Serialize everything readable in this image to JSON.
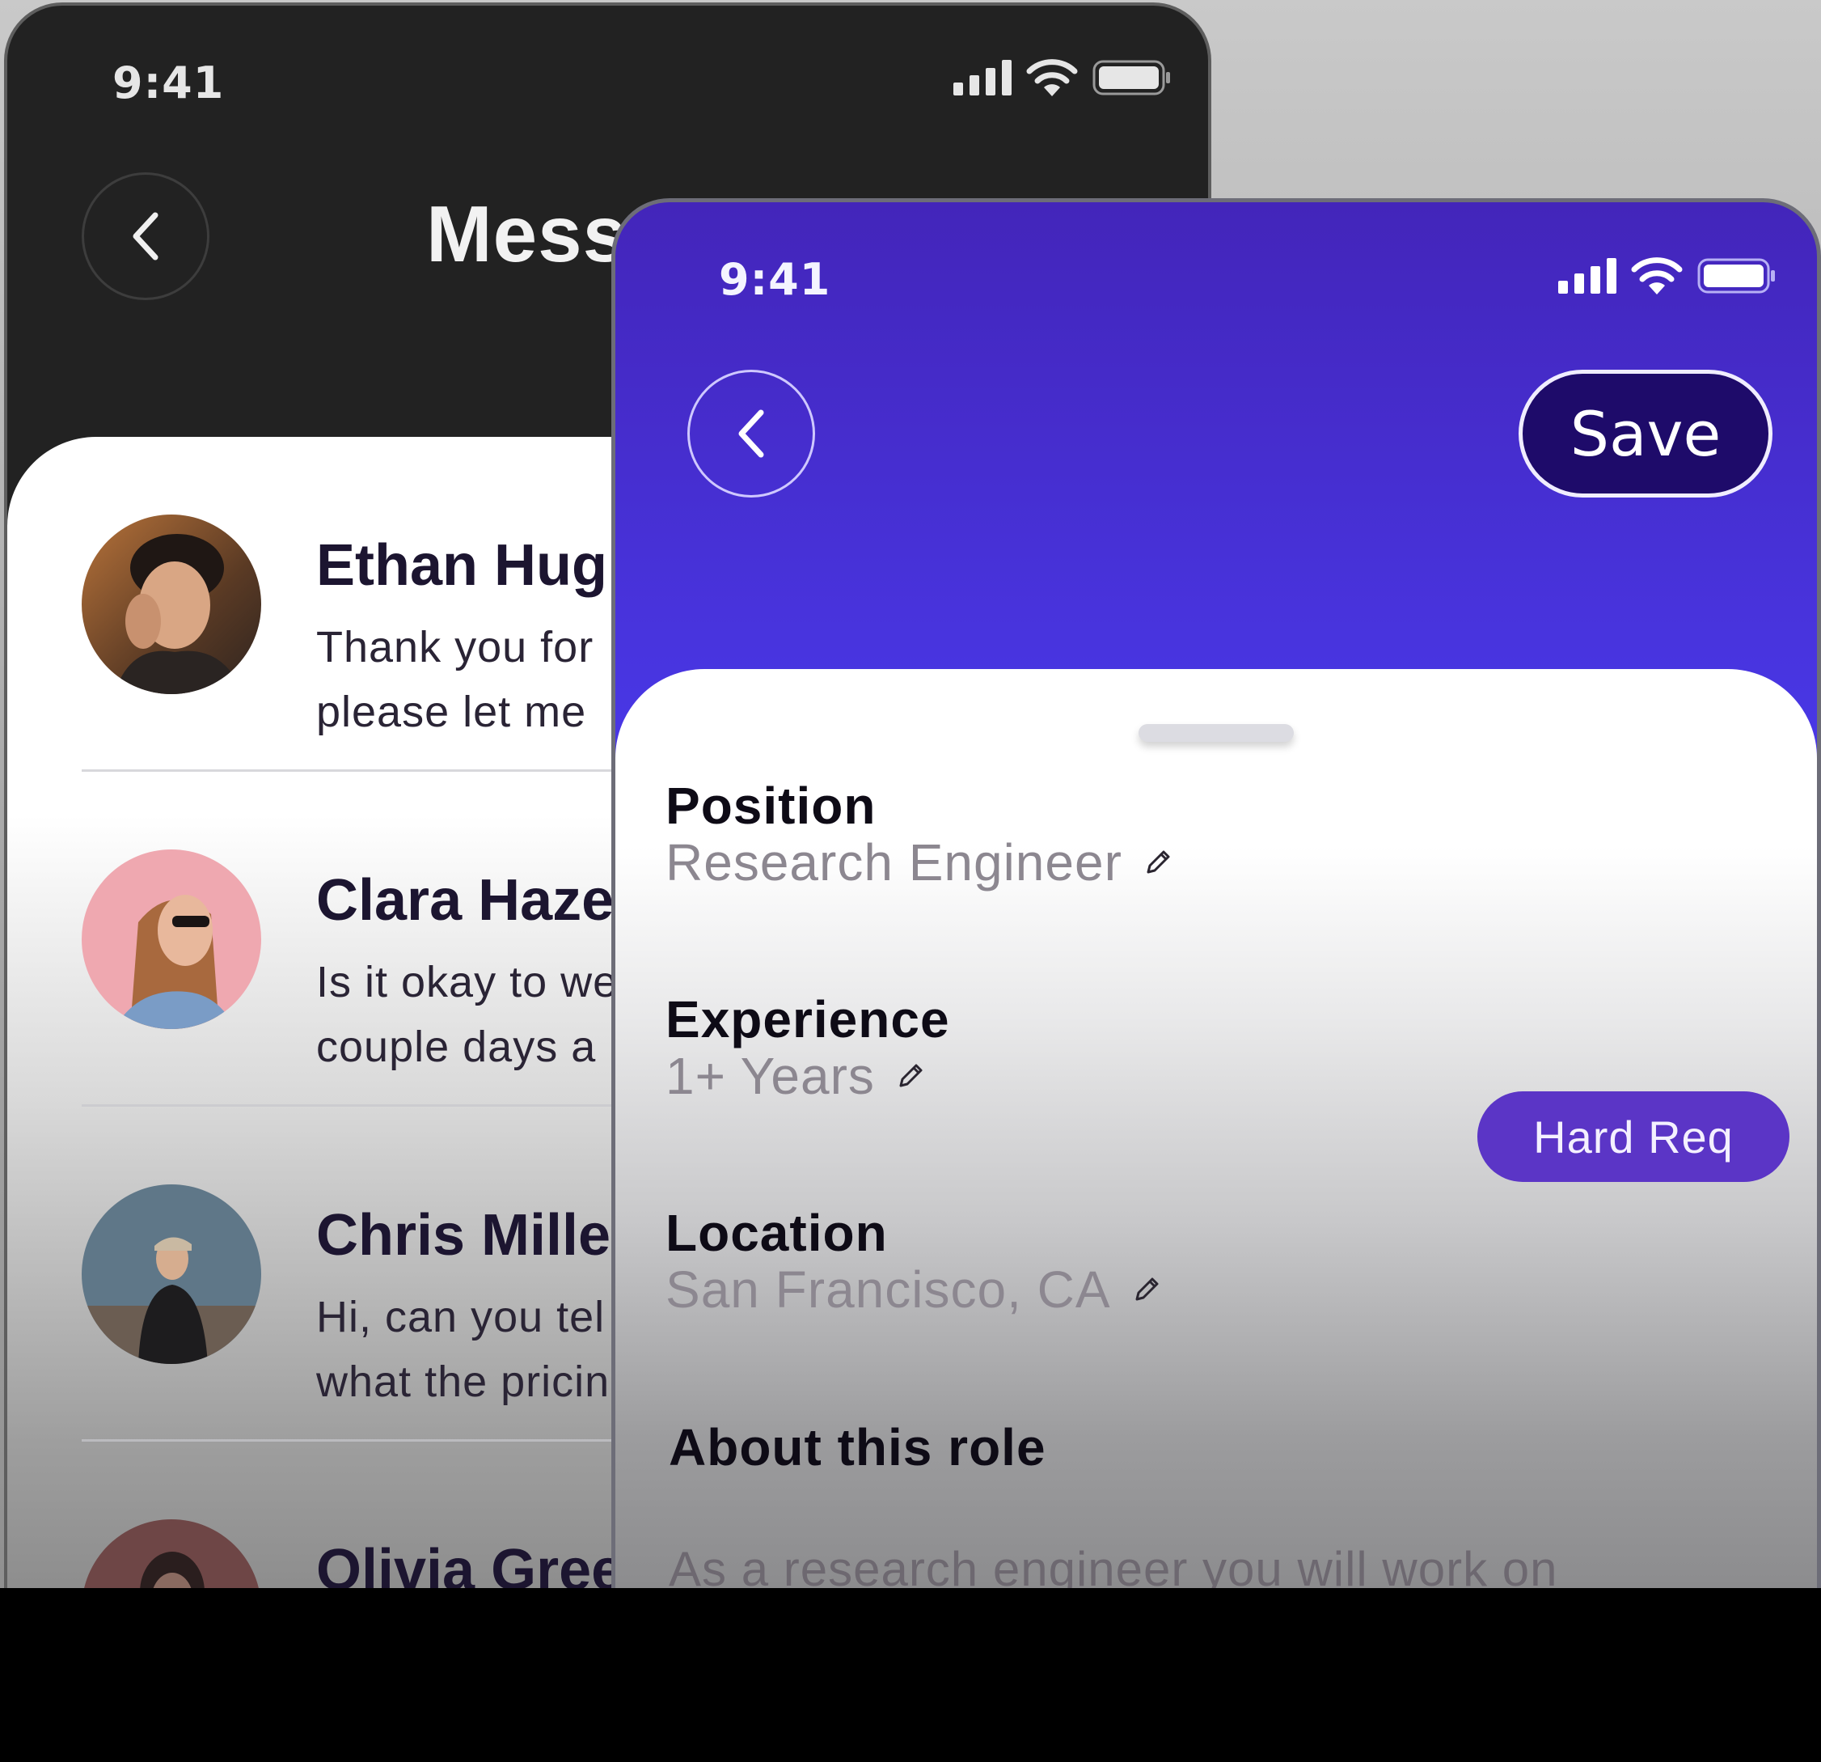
{
  "messages_screen": {
    "status_time": "9:41",
    "title": "Mess",
    "conversations": [
      {
        "name": "Ethan Hug",
        "preview_line1": "Thank you for",
        "preview_line2": "please let me"
      },
      {
        "name": "Clara Haze",
        "preview_line1": "Is it okay to we",
        "preview_line2": "couple days a"
      },
      {
        "name": "Chris Mille",
        "preview_line1": "Hi, can you tel",
        "preview_line2": "what the pricin"
      },
      {
        "name": "Olivia Gree",
        "preview_line1": "",
        "preview_line2": ""
      }
    ]
  },
  "role_screen": {
    "status_time": "9:41",
    "save_label": "Save",
    "fields": {
      "position_label": "Position",
      "position_value": "Research Engineer",
      "experience_label": "Experience",
      "experience_value": "1+ Years",
      "experience_badge": "Hard Req",
      "location_label": "Location",
      "location_value": "San Francisco, CA",
      "about_label": "About this role",
      "about_text": "As a research engineer you will work on"
    }
  },
  "icons": {
    "back": "chevron-left-icon",
    "edit": "pencil-icon",
    "signal": "cellular-signal-icon",
    "wifi": "wifi-icon",
    "battery": "battery-icon"
  },
  "colors": {
    "accent_purple": "#4a3bf0",
    "save_button": "#1e0b6a",
    "badge": "#5b35c6",
    "dark_bg": "#222222"
  }
}
